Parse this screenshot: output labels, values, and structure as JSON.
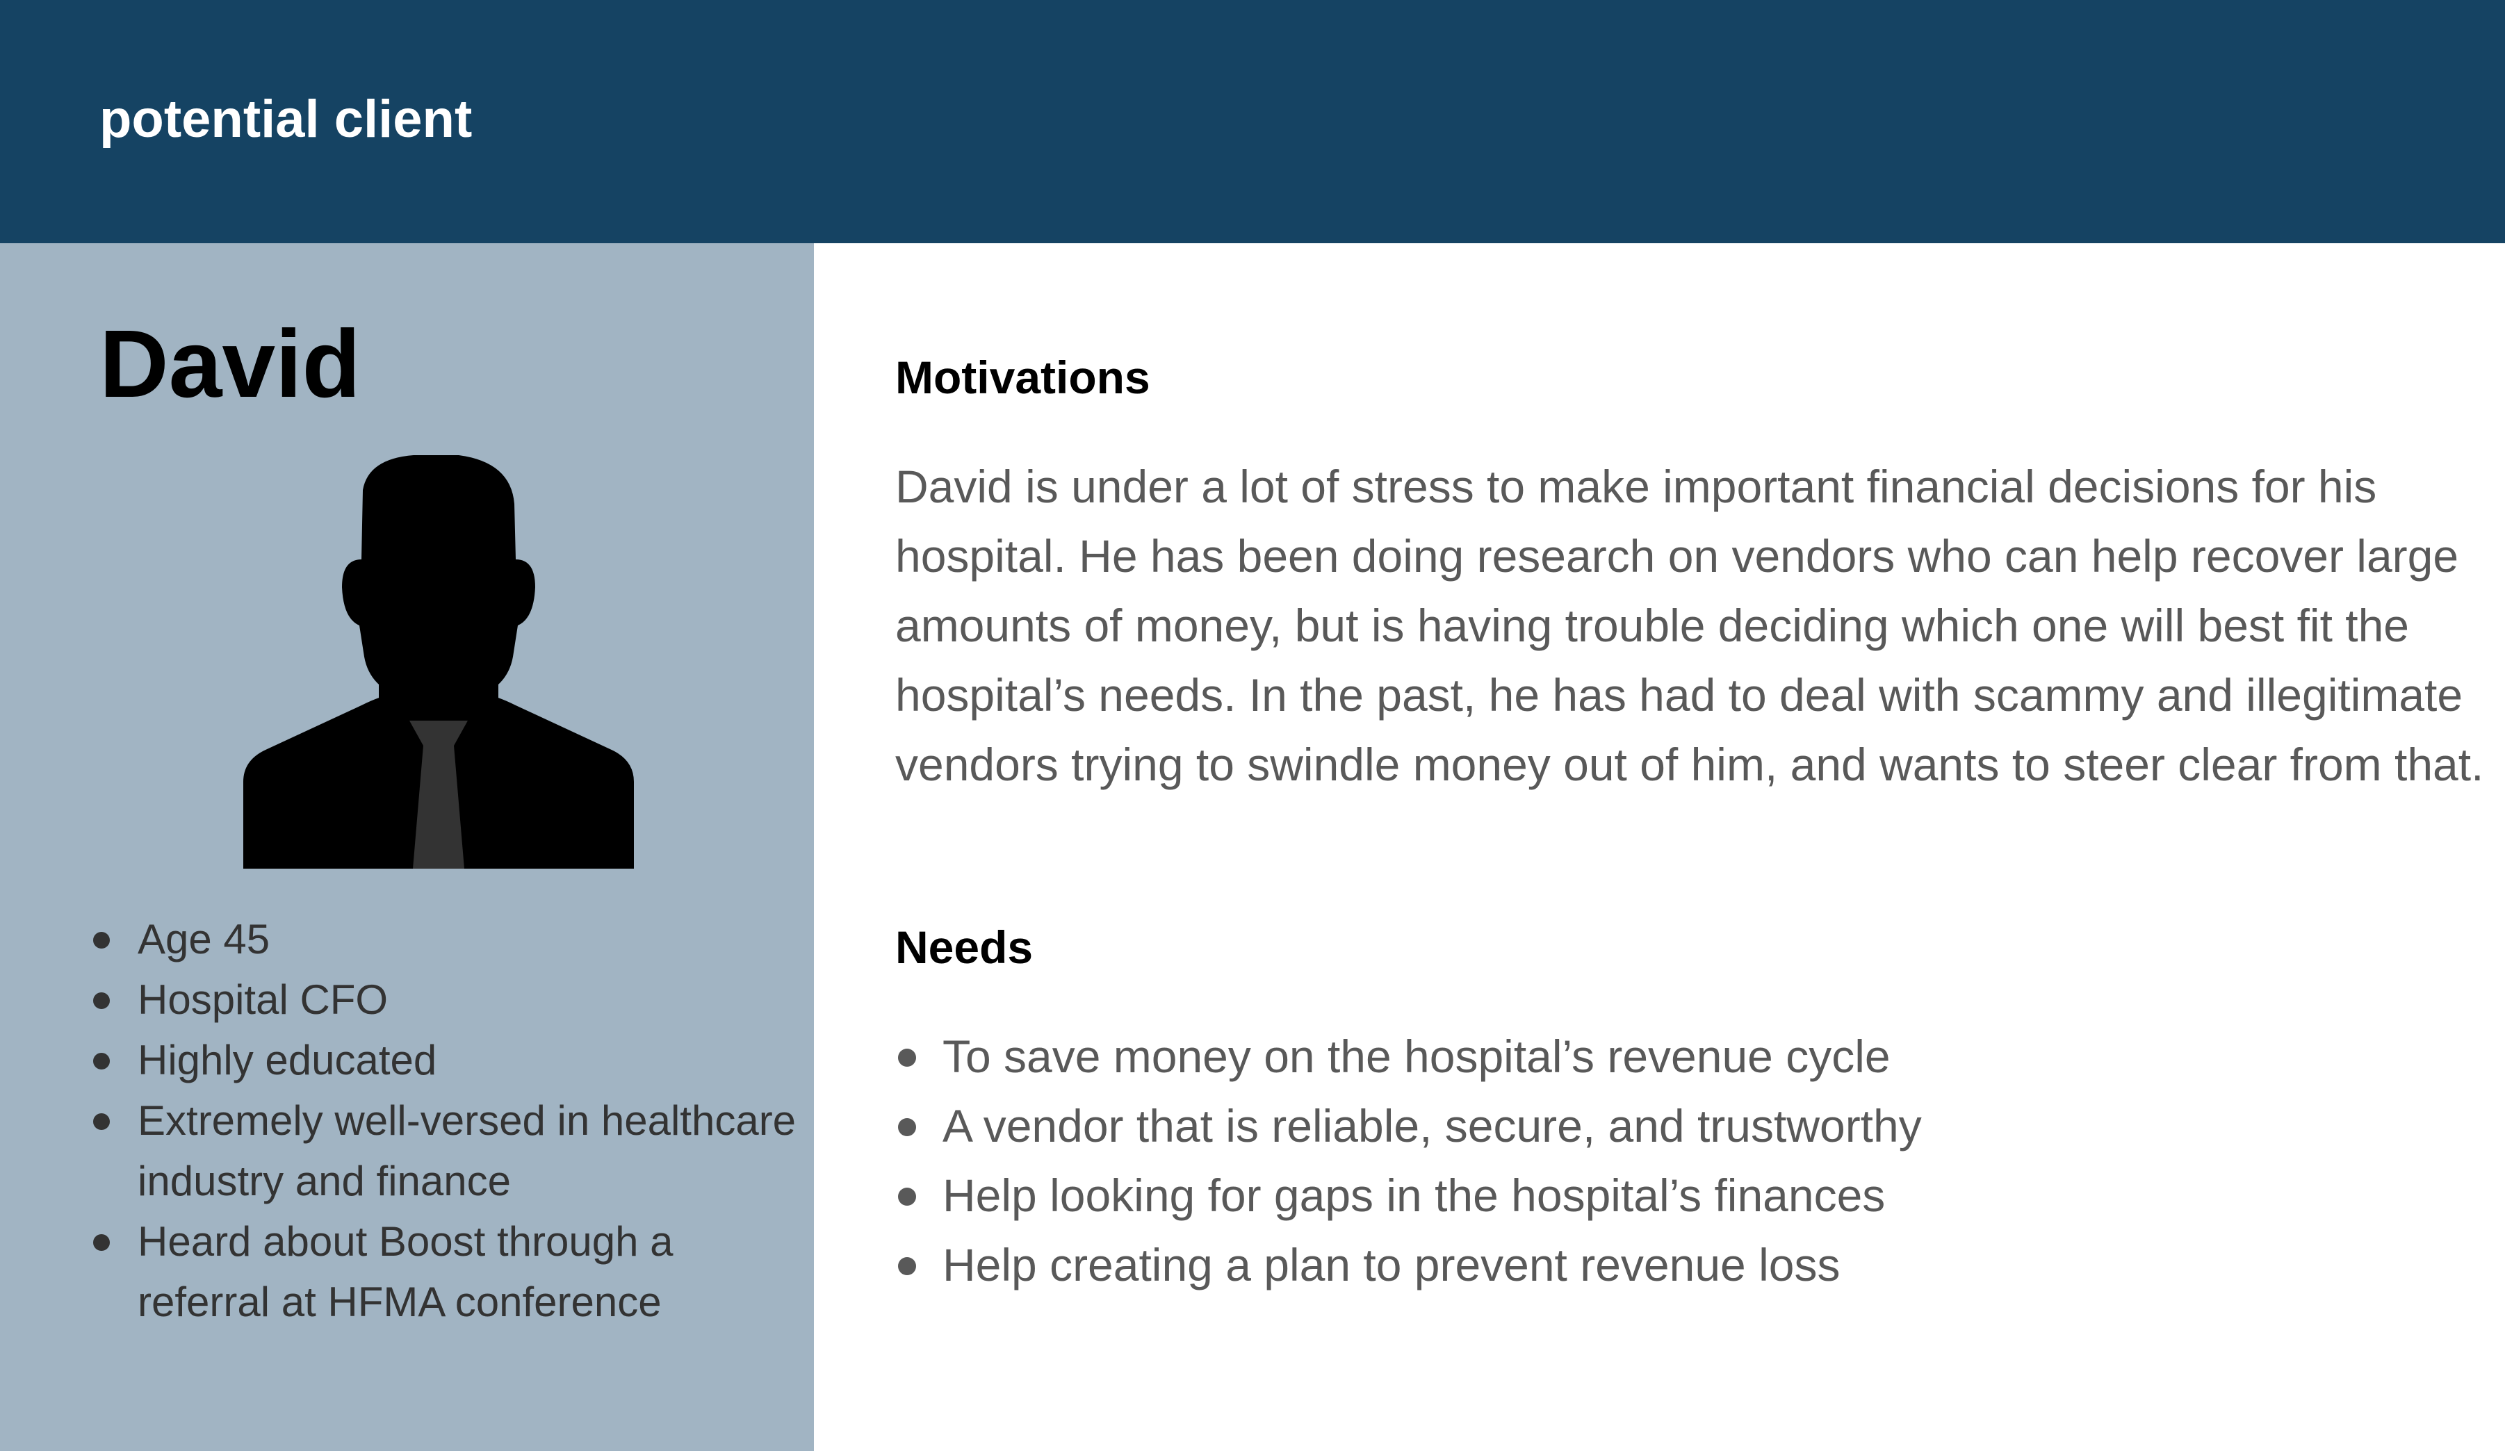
{
  "header": {
    "title": "potential client",
    "background_color": "#154363"
  },
  "persona": {
    "name": "David",
    "avatar_icon": "businessman-silhouette-icon",
    "sidebar_color": "#a1b4c3",
    "attributes": [
      "Age 45",
      "Hospital CFO",
      "Highly educated",
      "Extremely well-versed in healthcare industry and finance",
      "Heard about Boost through a referral at HFMA conference"
    ]
  },
  "motivations": {
    "heading": "Motivations",
    "text": "David is under a lot of stress to make important financial decisions for his hospital. He has been doing research on vendors who can help recover large amounts of money, but is having trouble deciding which one will best fit the hospital’s needs. In the past, he has had to deal with scammy and illegitimate vendors trying to swindle money out of him, and wants to steer clear from that."
  },
  "needs": {
    "heading": "Needs",
    "items": [
      "To save money on the hospital’s revenue cycle",
      "A vendor that is reliable, secure, and trustworthy",
      "Help looking for gaps in the hospital’s finances",
      "Help creating a plan to prevent revenue loss"
    ]
  }
}
